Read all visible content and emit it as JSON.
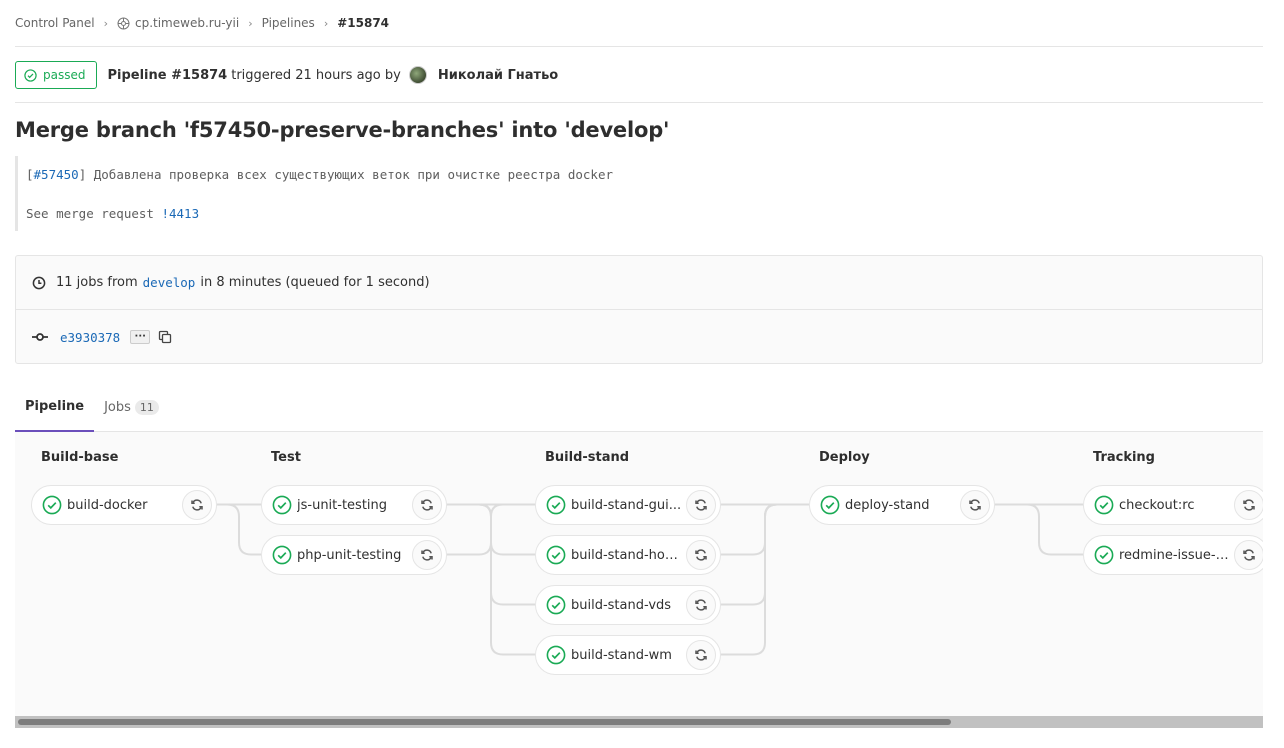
{
  "breadcrumb": {
    "items": [
      "Control Panel",
      "cp.timeweb.ru-yii",
      "Pipelines"
    ],
    "current": "#15874"
  },
  "header": {
    "status": "passed",
    "pipeline_label": "Pipeline #15874",
    "triggered": "triggered 21 hours ago by",
    "author": "Николай Гнатьо"
  },
  "commit": {
    "title": "Merge branch 'f57450-preserve-branches' into 'develop'",
    "desc_open": "[",
    "issue_ref": "#57450",
    "desc_rest": "] Добавлена проверка всех существующих веток при очистке реестра docker",
    "mr_prefix": "See merge request ",
    "mr_ref": "!4413"
  },
  "info": {
    "jobs_prefix": "11 jobs from",
    "branch": "develop",
    "jobs_suffix": "in 8 minutes (queued for 1 second)",
    "sha": "e3930378"
  },
  "tabs": [
    {
      "label": "Pipeline",
      "active": true
    },
    {
      "label": "Jobs",
      "count": "11"
    }
  ],
  "stages": [
    {
      "name": "Build-base",
      "jobs": [
        "build-docker"
      ]
    },
    {
      "name": "Test",
      "jobs": [
        "js-unit-testing",
        "php-unit-testing"
      ]
    },
    {
      "name": "Build-stand",
      "jobs": [
        "build-stand-gui...",
        "build-stand-hos...",
        "build-stand-vds",
        "build-stand-wm"
      ]
    },
    {
      "name": "Deploy",
      "jobs": [
        "deploy-stand"
      ]
    },
    {
      "name": "Tracking",
      "jobs": [
        "checkout:rc",
        "redmine-issue-t..."
      ]
    }
  ],
  "colors": {
    "success": "#1aaa55",
    "link": "#1b69b6",
    "active_tab": "#6b4fbb"
  },
  "icons": {
    "status": "check-circle-icon",
    "retry": "retry-icon",
    "clock": "clock-icon",
    "commit": "commit-icon",
    "copy": "copy-icon"
  }
}
